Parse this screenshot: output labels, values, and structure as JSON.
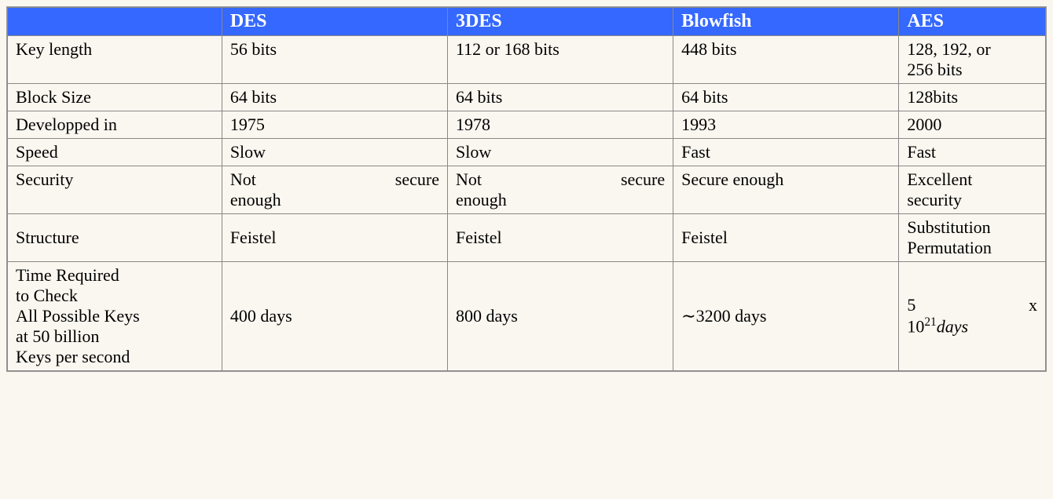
{
  "chart_data": {
    "type": "table",
    "columns": [
      "",
      "DES",
      "3DES",
      "Blowfish",
      "AES"
    ],
    "rows": [
      {
        "label": "Key length",
        "DES": "56 bits",
        "3DES": "112 or 168 bits",
        "Blowfish": "448 bits",
        "AES": "128, 192, or 256 bits"
      },
      {
        "label": "Block Size",
        "DES": "64 bits",
        "3DES": "64 bits",
        "Blowfish": "64 bits",
        "AES": "128bits"
      },
      {
        "label": "Developped in",
        "DES": "1975",
        "3DES": "1978",
        "Blowfish": "1993",
        "AES": "2000"
      },
      {
        "label": "Speed",
        "DES": "Slow",
        "3DES": "Slow",
        "Blowfish": "Fast",
        "AES": "Fast"
      },
      {
        "label": "Security",
        "DES": "Not secure enough",
        "3DES": "Not secure enough",
        "Blowfish": "Secure enough",
        "AES": "Excellent security"
      },
      {
        "label": "Structure",
        "DES": "Feistel",
        "3DES": "Feistel",
        "Blowfish": "Feistel",
        "AES": "Substitution Permutation"
      },
      {
        "label": "Time Required to Check All Possible Keys at 50 billion Keys per second",
        "DES": "400 days",
        "3DES": "800 days",
        "Blowfish": "~3200 days",
        "AES": "5 x 10^21 days"
      }
    ]
  },
  "headers": {
    "col0": "",
    "col1": "DES",
    "col2": "3DES",
    "col3": "Blowfish",
    "col4": "AES"
  },
  "rows": {
    "keylength": {
      "label": "Key length",
      "des": "56 bits",
      "tdes": "112 or 168 bits",
      "blowfish": "448 bits",
      "aes_l1": "128, 192, or",
      "aes_l2": "256 bits"
    },
    "blocksize": {
      "label": "Block Size",
      "des": "64 bits",
      "tdes": "64 bits",
      "blowfish": "64 bits",
      "aes": "128bits"
    },
    "developed": {
      "label": "Developped in",
      "des": "1975",
      "tdes": "1978",
      "blowfish": "1993",
      "aes": "2000"
    },
    "speed": {
      "label": "Speed",
      "des": "Slow",
      "tdes": "Slow",
      "blowfish": "Fast",
      "aes": "Fast"
    },
    "security": {
      "label": "Security",
      "des_word1": "Not",
      "des_word2": "secure",
      "des_l2": "enough",
      "tdes_word1": "Not",
      "tdes_word2": "secure",
      "tdes_l2": "enough",
      "blowfish": "Secure enough",
      "aes_l1": "Excellent",
      "aes_l2": "security"
    },
    "structure": {
      "label": "Structure",
      "des": "Feistel",
      "tdes": "Feistel",
      "blowfish": "Feistel",
      "aes_l1": "Substitution",
      "aes_l2": "Permutation"
    },
    "time": {
      "label_l1": "Time Required",
      "label_l2": "to Check",
      "label_l3": "All Possible Keys",
      "label_l4": "at 50 billion",
      "label_l5": "Keys per second",
      "des": "400 days",
      "tdes": "800 days",
      "blowfish": "∼3200 days",
      "aes_p1": "5",
      "aes_p2": "x",
      "aes_p3": "10",
      "aes_exp": "21",
      "aes_p4": "days"
    }
  }
}
